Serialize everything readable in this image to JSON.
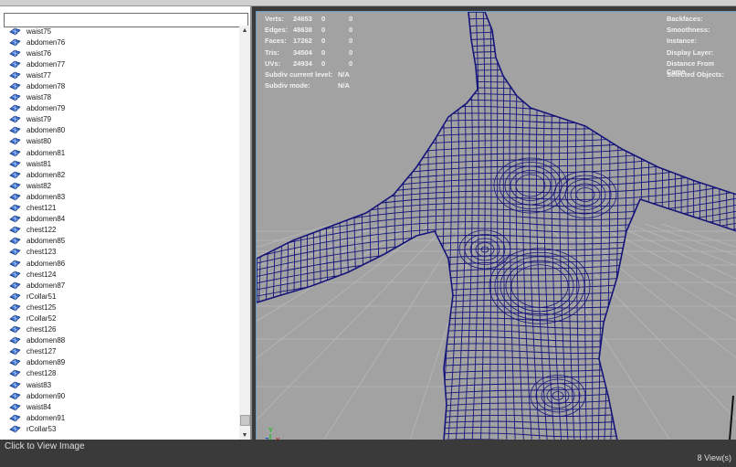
{
  "outliner": {
    "search_value": "",
    "items": [
      "waist75",
      "abdomen76",
      "waist76",
      "abdomen77",
      "waist77",
      "abdomen78",
      "waist78",
      "abdomen79",
      "waist79",
      "abdomen80",
      "waist80",
      "abdomen81",
      "waist81",
      "abdomen82",
      "waist82",
      "abdomen83",
      "chest121",
      "abdomen84",
      "chest122",
      "abdomen85",
      "chest123",
      "abdomen86",
      "chest124",
      "abdomen87",
      "rCollar51",
      "chest125",
      "rCollar52",
      "chest126",
      "abdomen88",
      "chest127",
      "abdomen89",
      "chest128",
      "waist83",
      "abdomen90",
      "waist84",
      "abdomen91",
      "rCollar53"
    ],
    "scroll_up": "▲",
    "scroll_down": "▼"
  },
  "hud": {
    "stats": [
      {
        "label": "Verts:",
        "v1": "24653",
        "v2": "0",
        "v3": "0"
      },
      {
        "label": "Edges:",
        "v1": "48638",
        "v2": "0",
        "v3": "0"
      },
      {
        "label": "Faces:",
        "v1": "17262",
        "v2": "0",
        "v3": "0"
      },
      {
        "label": "Tris:",
        "v1": "34504",
        "v2": "0",
        "v3": "0"
      },
      {
        "label": "UVs:",
        "v1": "24934",
        "v2": "0",
        "v3": "0"
      }
    ],
    "subdiv_level_label": "Subdiv current level:",
    "subdiv_level_value": "N/A",
    "subdiv_mode_label": "Subdiv mode:",
    "subdiv_mode_value": "N/A",
    "right": [
      "Backfaces:",
      "Smoothness:",
      "Instance:",
      "Display Layer:",
      "Distance From Came",
      "Selected Objects:"
    ],
    "axis": {
      "y": "Y",
      "z": "Z",
      "x": "X"
    }
  },
  "footer": {
    "link": "Click to View Image",
    "views": "8 View(s)"
  },
  "colors": {
    "wire": "#15147a",
    "viewport_bg": "#a2a2a2",
    "grid": "#b8b8b8",
    "axis_x": "#d42020",
    "axis_y": "#20c020",
    "axis_z": "#2050d0"
  }
}
